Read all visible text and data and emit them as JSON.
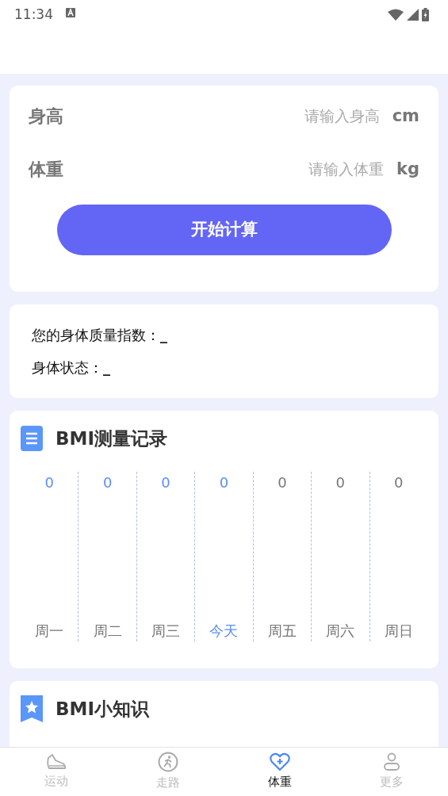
{
  "status_bar": {
    "time": "11:34"
  },
  "form": {
    "fields": [
      {
        "label": "身高",
        "placeholder": "请输入身高",
        "unit": "cm"
      },
      {
        "label": "体重",
        "placeholder": "请输入体重",
        "unit": "kg"
      }
    ],
    "button": "开始计算"
  },
  "result": {
    "lines": [
      {
        "label": "您的身体质量指数：",
        "value": "_"
      },
      {
        "label": "身体状态：",
        "value": "_"
      }
    ]
  },
  "record": {
    "title": "BMI测量记录",
    "days": [
      {
        "label": "周一",
        "value": "0",
        "highlighted": true,
        "selected": false
      },
      {
        "label": "周二",
        "value": "0",
        "highlighted": true,
        "selected": false
      },
      {
        "label": "周三",
        "value": "0",
        "highlighted": true,
        "selected": false
      },
      {
        "label": "今天",
        "value": "0",
        "highlighted": true,
        "selected": true
      },
      {
        "label": "周五",
        "value": "0",
        "highlighted": false,
        "selected": false
      },
      {
        "label": "周六",
        "value": "0",
        "highlighted": false,
        "selected": false
      },
      {
        "label": "周日",
        "value": "0",
        "highlighted": false,
        "selected": false
      }
    ]
  },
  "knowledge": {
    "title": "BMI小知识"
  },
  "tabs": [
    {
      "label": "运动",
      "kind": "shoe",
      "selected": false
    },
    {
      "label": "走路",
      "kind": "walk",
      "selected": false
    },
    {
      "label": "体重",
      "kind": "heart",
      "selected": true
    },
    {
      "label": "更多",
      "kind": "person",
      "selected": false
    }
  ]
}
